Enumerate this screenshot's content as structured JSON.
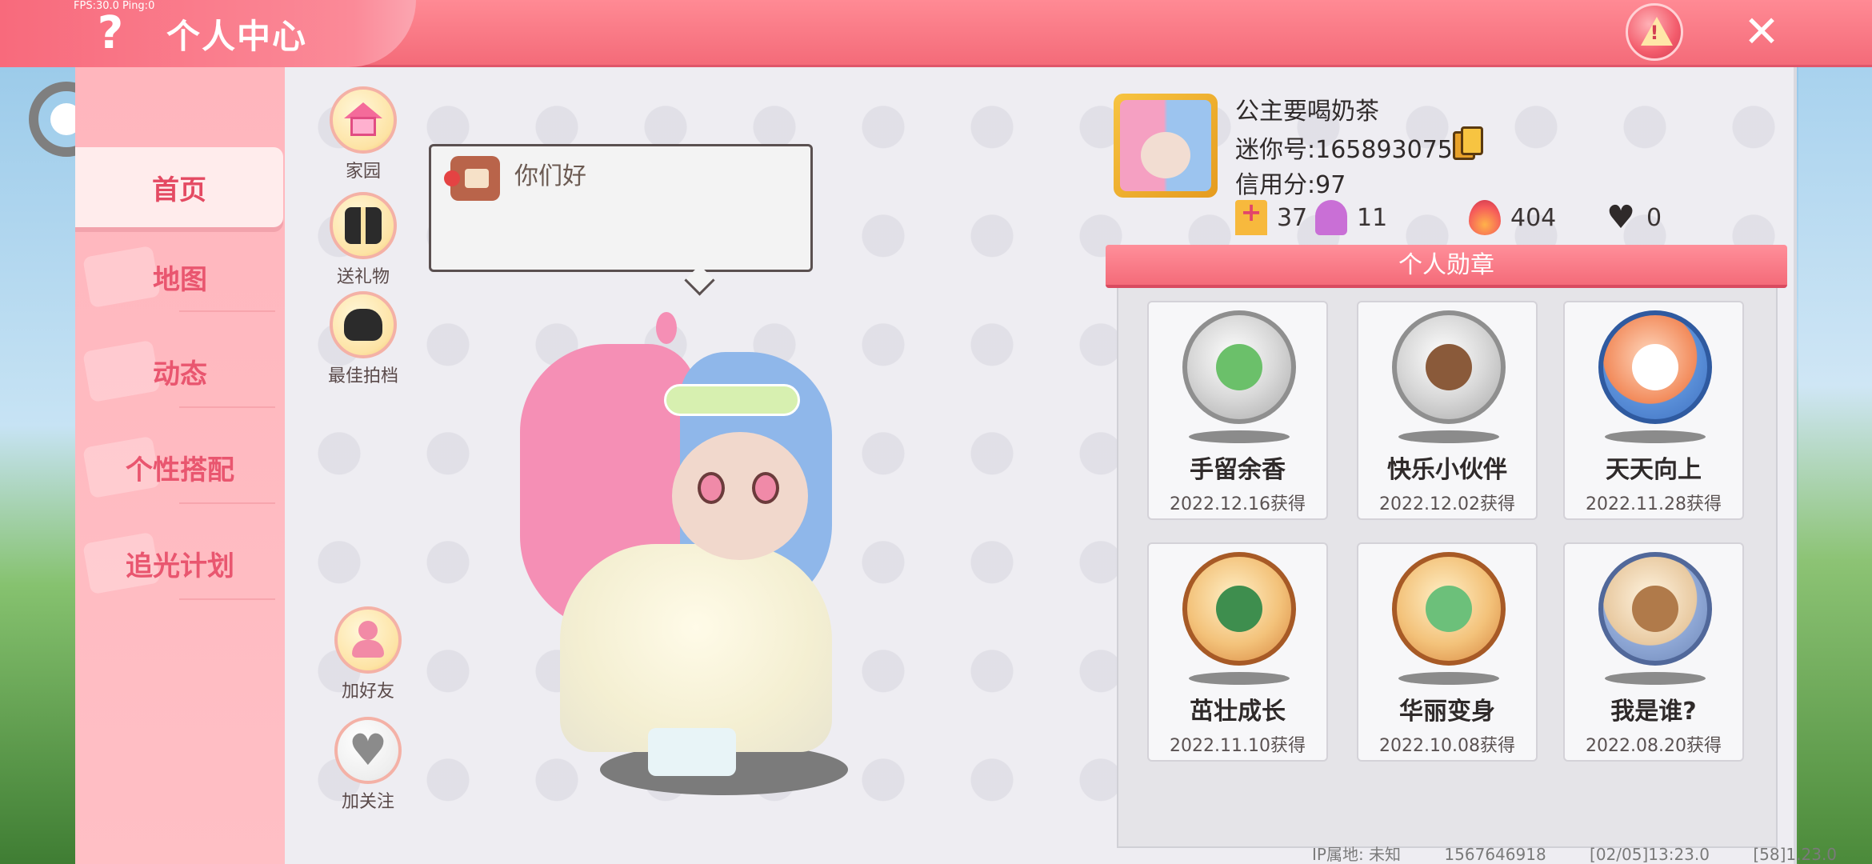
{
  "debug": {
    "fps_text": "FPS:30.0  Ping:0"
  },
  "header": {
    "title": "个人中心",
    "help_glyph": "?",
    "close_glyph": "✕",
    "report_glyph": "!"
  },
  "nav": {
    "items": [
      {
        "label": "首页",
        "active": true
      },
      {
        "label": "地图",
        "active": false
      },
      {
        "label": "动态",
        "active": false
      },
      {
        "label": "个性搭配",
        "active": false
      },
      {
        "label": "追光计划",
        "active": false
      }
    ]
  },
  "actions": {
    "home": "家园",
    "gift": "送礼物",
    "partner": "最佳拍档",
    "add_friend": "加好友",
    "follow": "加关注"
  },
  "bubble": {
    "message": "你们好"
  },
  "profile": {
    "name": "公主要喝奶茶",
    "mini_id": "迷你号:1658930759",
    "credit": "信用分:97",
    "stats": {
      "flag": "37",
      "trophy": "11",
      "fire": "404",
      "hearts": "0"
    }
  },
  "badges": {
    "title": "个人勋章",
    "items": [
      {
        "name": "手留余香",
        "date": "2022.12.16获得",
        "style": "silver"
      },
      {
        "name": "快乐小伙伴",
        "date": "2022.12.02获得",
        "style": "silver"
      },
      {
        "name": "天天向上",
        "date": "2022.11.28获得",
        "style": "blue"
      },
      {
        "name": "茁壮成长",
        "date": "2022.11.10获得",
        "style": "bronze"
      },
      {
        "name": "华丽变身",
        "date": "2022.10.08获得",
        "style": "bronze"
      },
      {
        "name": "我是谁?",
        "date": "2022.08.20获得",
        "style": "bluegrey"
      }
    ]
  },
  "footer": {
    "ip": "IP属地: 未知",
    "uid": "1567646918",
    "time": "[02/05]13:23.0",
    "version": "[58]1.23.0"
  }
}
